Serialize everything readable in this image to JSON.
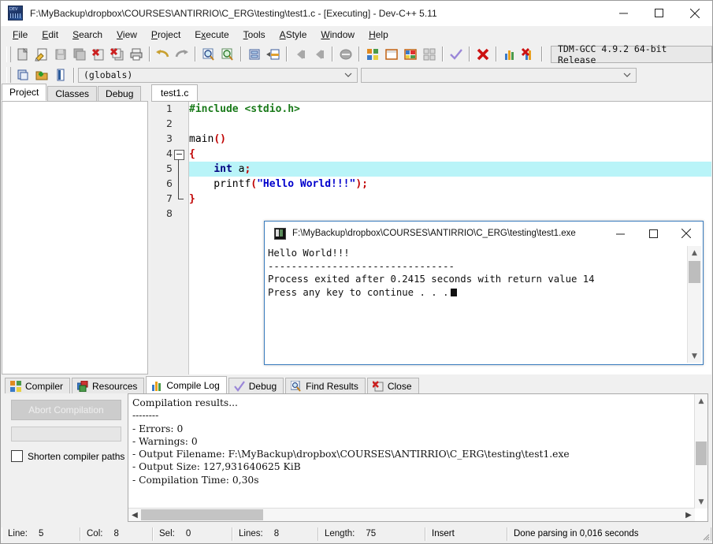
{
  "window": {
    "title": "F:\\MyBackup\\dropbox\\COURSES\\ANTIRRIO\\C_ERG\\testing\\test1.c - [Executing] - Dev-C++ 5.11",
    "app_icon": "devcpp-icon",
    "minimize": "minimize-icon",
    "maximize": "maximize-icon",
    "close": "close-icon"
  },
  "menu": [
    {
      "label": "File",
      "accel": "F"
    },
    {
      "label": "Edit",
      "accel": "E"
    },
    {
      "label": "Search",
      "accel": "S"
    },
    {
      "label": "View",
      "accel": "V"
    },
    {
      "label": "Project",
      "accel": "P"
    },
    {
      "label": "Execute",
      "accel": "x"
    },
    {
      "label": "Tools",
      "accel": "T"
    },
    {
      "label": "AStyle",
      "accel": "A"
    },
    {
      "label": "Window",
      "accel": "W"
    },
    {
      "label": "Help",
      "accel": "H"
    }
  ],
  "toolbar": {
    "compiler_set": "TDM-GCC 4.9.2 64-bit Release",
    "icons": [
      "new-file-icon",
      "open-file-icon",
      "save-icon",
      "save-all-icon",
      "close-file-icon",
      "close-all-icon",
      "print-icon",
      "undo-icon",
      "redo-icon",
      "find-icon",
      "find-replace-icon",
      "goto-line-icon",
      "goto-function-icon",
      "back-icon",
      "forward-icon",
      "toggle-breakpoint-icon",
      "compile-icon",
      "run-icon",
      "compile-run-icon",
      "rebuild-all-icon",
      "syntax-check-icon",
      "stop-execution-icon",
      "profile-icon",
      "delete-profile-icon"
    ],
    "second_row_icons": [
      "new-project-icon",
      "add-to-project-icon",
      "project-options-icon"
    ],
    "globals_combo": "(globals)",
    "second_combo": ""
  },
  "left_panel": {
    "tabs": [
      {
        "label": "Project",
        "active": true
      },
      {
        "label": "Classes",
        "active": false
      },
      {
        "label": "Debug",
        "active": false
      }
    ]
  },
  "editor": {
    "tab": "test1.c",
    "highlight_line": 5,
    "lines": [
      {
        "n": 1,
        "tokens": [
          {
            "t": "#include <stdio.h>",
            "c": "pre"
          }
        ]
      },
      {
        "n": 2,
        "tokens": []
      },
      {
        "n": 3,
        "tokens": [
          {
            "t": "main",
            "c": "id"
          },
          {
            "t": "()",
            "c": "sym"
          }
        ]
      },
      {
        "n": 4,
        "tokens": [
          {
            "t": "{",
            "c": "sym"
          }
        ]
      },
      {
        "n": 5,
        "tokens": [
          {
            "t": "    ",
            "c": "id"
          },
          {
            "t": "int",
            "c": "kw"
          },
          {
            "t": " a",
            "c": "id"
          },
          {
            "t": ";",
            "c": "sym"
          }
        ]
      },
      {
        "n": 6,
        "tokens": [
          {
            "t": "    printf",
            "c": "id"
          },
          {
            "t": "(",
            "c": "sym"
          },
          {
            "t": "\"Hello World!!!\"",
            "c": "str"
          },
          {
            "t": ");",
            "c": "sym"
          }
        ]
      },
      {
        "n": 7,
        "tokens": [
          {
            "t": "}",
            "c": "sym"
          }
        ]
      },
      {
        "n": 8,
        "tokens": []
      }
    ]
  },
  "console": {
    "title": "F:\\MyBackup\\dropbox\\COURSES\\ANTIRRIO\\C_ERG\\testing\\test1.exe",
    "icon": "console-icon",
    "minimize": "minimize-icon",
    "maximize": "maximize-icon",
    "close": "close-icon",
    "output": "Hello World!!!\n--------------------------------\nProcess exited after 0.2415 seconds with return value 14\nPress any key to continue . . ."
  },
  "bottom_panel": {
    "tabs": [
      {
        "label": "Compiler",
        "icon": "compiler-icon",
        "active": false
      },
      {
        "label": "Resources",
        "icon": "resources-icon",
        "active": false
      },
      {
        "label": "Compile Log",
        "icon": "compile-log-icon",
        "active": true
      },
      {
        "label": "Debug",
        "icon": "debug-icon",
        "active": false
      },
      {
        "label": "Find Results",
        "icon": "find-results-icon",
        "active": false
      },
      {
        "label": "Close",
        "icon": "close-panel-icon",
        "active": false
      }
    ],
    "abort_button": "Abort Compilation",
    "shorten_paths_label": "Shorten compiler paths",
    "shorten_paths_checked": false,
    "log": "Compilation results...\n--------\n- Errors: 0\n- Warnings: 0\n- Output Filename: F:\\MyBackup\\dropbox\\COURSES\\ANTIRRIO\\C_ERG\\testing\\test1.exe\n- Output Size: 127,931640625 KiB\n- Compilation Time: 0,30s"
  },
  "status_bar": {
    "line_label": "Line:",
    "line_value": "5",
    "col_label": "Col:",
    "col_value": "8",
    "sel_label": "Sel:",
    "sel_value": "0",
    "lines_label": "Lines:",
    "lines_value": "8",
    "length_label": "Length:",
    "length_value": "75",
    "mode": "Insert",
    "message": "Done parsing in 0,016 seconds"
  },
  "colors": {
    "accent": "#3a7cbe",
    "highlight": "#b9f4f8",
    "preprocessor": "#1a7a1a",
    "keyword": "#000080",
    "string": "#0000cc",
    "symbol": "#c00000",
    "chrome": "#f0f0f0"
  }
}
